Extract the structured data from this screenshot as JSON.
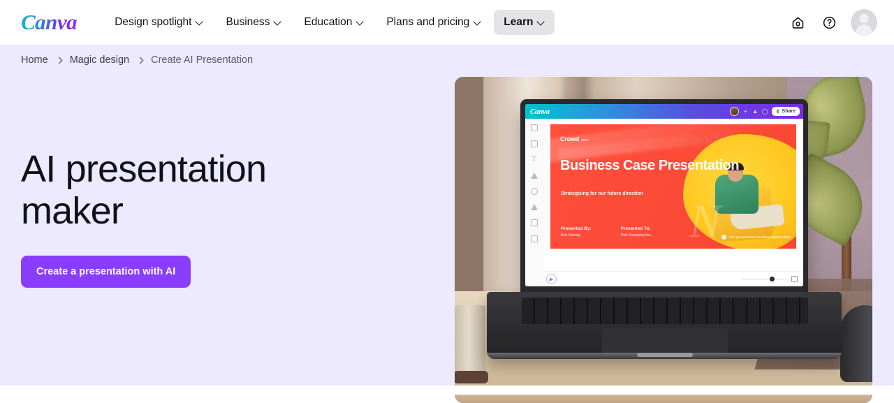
{
  "header": {
    "logo_text": "Canva",
    "nav": [
      {
        "label": "Design spotlight",
        "has_caret": true,
        "active": false
      },
      {
        "label": "Business",
        "has_caret": true,
        "active": false
      },
      {
        "label": "Education",
        "has_caret": true,
        "active": false
      },
      {
        "label": "Plans and pricing",
        "has_caret": true,
        "active": false
      },
      {
        "label": "Learn",
        "has_caret": true,
        "active": true
      }
    ],
    "actions": [
      {
        "icon": "home-icon"
      },
      {
        "icon": "help-icon"
      },
      {
        "icon": "avatar"
      }
    ]
  },
  "breadcrumb": {
    "items": [
      {
        "label": "Home",
        "current": false
      },
      {
        "label": "Magic design",
        "current": false
      },
      {
        "label": "Create AI Presentation",
        "current": true
      }
    ]
  },
  "hero": {
    "title": "AI presentation maker",
    "cta_label": "Create a presentation with AI",
    "background_color": "#EDE9FE",
    "cta_color": "#8B3DFF"
  },
  "hero_image": {
    "alt": "Laptop on a wooden desk showing the Canva editor with a Business Case Presentation slide",
    "editor": {
      "logo_text": "Canva",
      "share_label": "Share",
      "top_bar_gradient": [
        "#00C4CC",
        "#7D2AE8"
      ],
      "rail_icons": [
        "design-icon",
        "elements-icon",
        "text-icon",
        "brand-icon",
        "uploads-icon",
        "draw-icon",
        "projects-icon",
        "apps-icon"
      ],
      "magic_button": "magic-switch-icon",
      "zoom_grid_icon": "grid-view-icon"
    },
    "slide": {
      "brand_name": "Crowd",
      "brand_sub": "zero",
      "title": "Business Case Presentation",
      "subtitle": "Strategizing for our future direction",
      "presented_by_label": "Presented By:",
      "presented_by_value": "Ken Koenig",
      "presented_to_label": "Presented To:",
      "presented_to_value": "Port Company Inc.",
      "note": "This presentation identifies opportunities",
      "background_color": "#FB4B38"
    }
  }
}
